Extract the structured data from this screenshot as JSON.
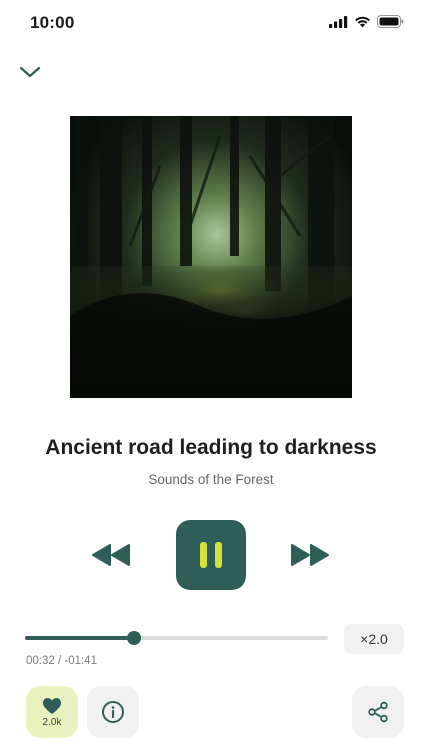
{
  "status": {
    "time": "10:00"
  },
  "track": {
    "title": "Ancient road leading to darkness",
    "artist": "Sounds of the Forest"
  },
  "player": {
    "state": "playing",
    "elapsed": "00:32",
    "remaining": "-01:41",
    "timecode": "00:32 / -01:41",
    "progress_fraction": 0.36,
    "speed": "×2.0"
  },
  "actions": {
    "like_count": "2.0k"
  },
  "icons": {
    "collapse": "chevron-down-icon",
    "rewind": "rewind-icon",
    "forward": "fast-forward-icon",
    "pause": "pause-icon",
    "like": "heart-icon",
    "info": "info-icon",
    "share": "share-icon"
  },
  "colors": {
    "accent": "#2f5e59",
    "pause_glyph": "#d2e13c",
    "like_bg": "#e9f2bf",
    "tile_bg": "#f1f1f1",
    "track_bg": "#dcdcdc"
  }
}
